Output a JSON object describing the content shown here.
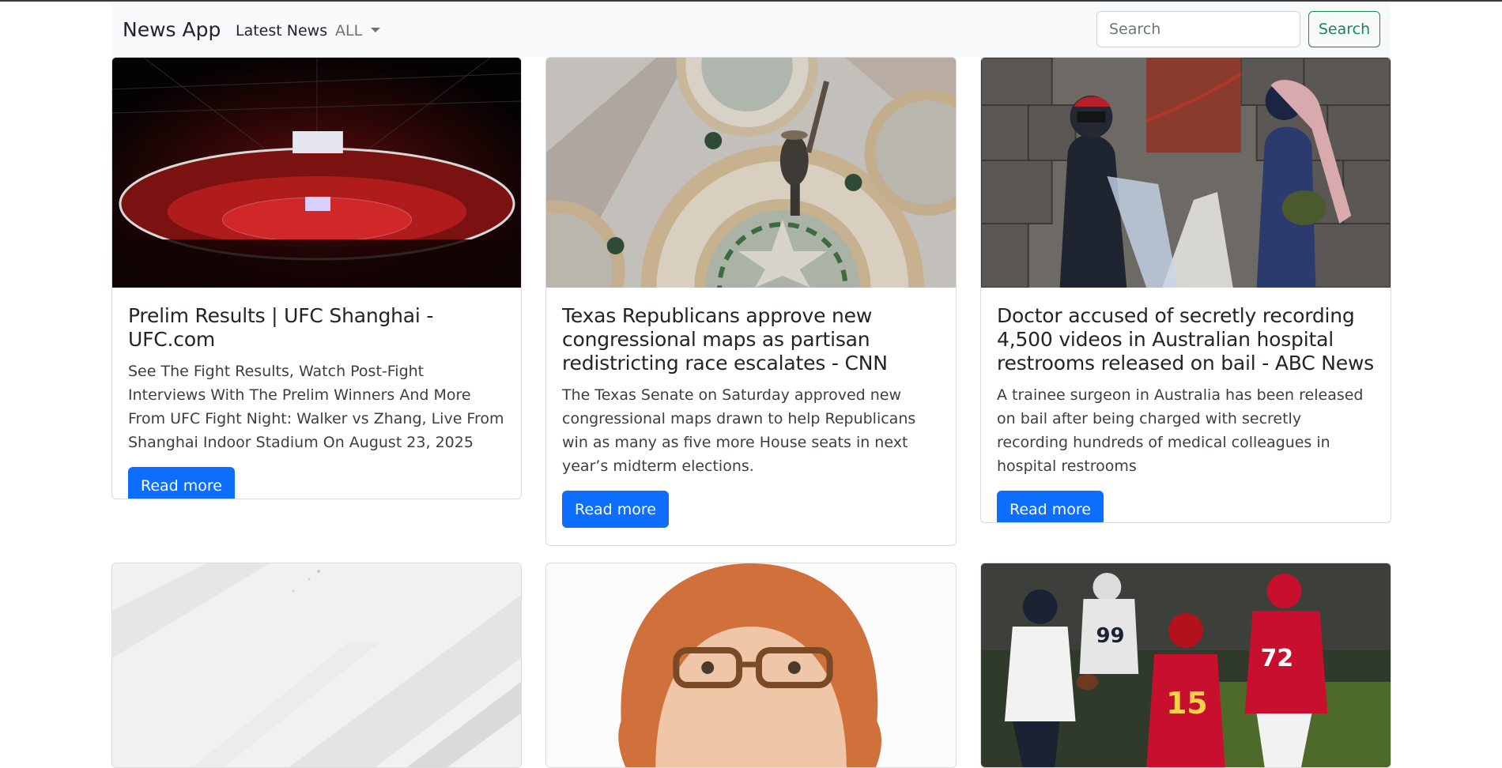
{
  "navbar": {
    "brand": "News App",
    "latest_label": "Latest News",
    "category_label": "ALL",
    "search_placeholder": "Search",
    "search_button": "Search"
  },
  "articles": [
    {
      "title": "Prelim Results | UFC Shanghai - UFC.com",
      "description": "See The Fight Results, Watch Post-Fight Interviews With The Prelim Winners And More From UFC Fight Night: Walker vs Zhang, Live From Shanghai Indoor Stadium On August 23, 2025",
      "button": "Read more"
    },
    {
      "title": "Texas Republicans approve new congressional maps as partisan redistricting race escalates - CNN",
      "description": "The Texas Senate on Saturday approved new congressional maps drawn to help Republicans win as many as five more House seats in next year’s midterm elections.",
      "button": "Read more"
    },
    {
      "title": "Doctor accused of secretly recording 4,500 videos in Australian hospital restrooms released on bail - ABC News",
      "description": "A trainee surgeon in Australia has been released on bail after being charged with secretly recording hundreds of medical colleagues in hospital restrooms",
      "button": "Read more"
    },
    {
      "title": "",
      "description": "",
      "button": ""
    },
    {
      "title": "",
      "description": "",
      "button": ""
    },
    {
      "title": "",
      "description": "",
      "button": ""
    }
  ],
  "colors": {
    "primary": "#0d6efd",
    "success": "#198754",
    "navbar_bg": "#f8f9fa"
  }
}
